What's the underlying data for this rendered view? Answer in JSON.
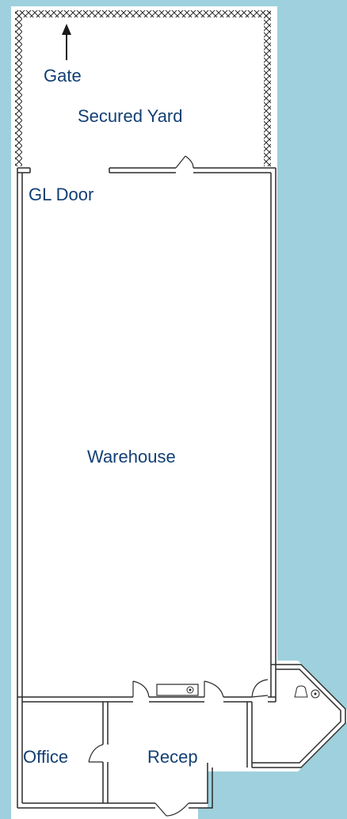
{
  "floor_plan": {
    "colors": {
      "background": "#9ed1dd",
      "floor": "#ffffff",
      "wall": "#2a2a2a",
      "label": "#123f73",
      "fence": "#2a2a2a"
    },
    "labels": {
      "gate": "Gate",
      "secured_yard": "Secured Yard",
      "gl_door": "GL Door",
      "warehouse": "Warehouse",
      "office": "Office",
      "recep": "Recep"
    },
    "icons": {
      "gate_arrow": "arrow-up-icon",
      "fence": "chain-link-fence-icon",
      "sink": "sink-icon",
      "toilet": "toilet-icon"
    }
  }
}
